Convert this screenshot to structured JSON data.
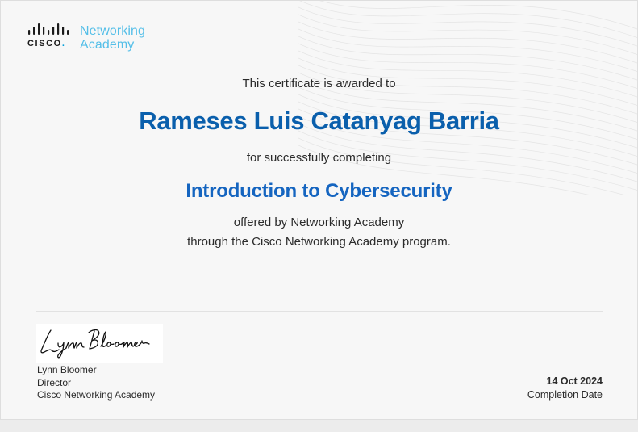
{
  "logo": {
    "brand": "CISCO",
    "name_line1": "Networking",
    "name_line2": "Academy"
  },
  "certificate": {
    "awarded_text": "This certificate is awarded to",
    "recipient": "Rameses Luis Catanyag Barria",
    "completing_text": "for successfully completing",
    "course": "Introduction to Cybersecurity",
    "offered_line1": "offered by Networking Academy",
    "offered_line2": "through the Cisco Networking Academy program."
  },
  "signer": {
    "signature_script": "Lynn Bloomer",
    "name": "Lynn Bloomer",
    "title": "Director",
    "organization": "Cisco Networking Academy"
  },
  "completion": {
    "date": "14 Oct 2024",
    "label": "Completion Date"
  },
  "colors": {
    "recipient": "#0a5fac",
    "course": "#1565c0",
    "academy_logo_text": "#55bfe8",
    "cisco_dot": "#049fd9"
  }
}
